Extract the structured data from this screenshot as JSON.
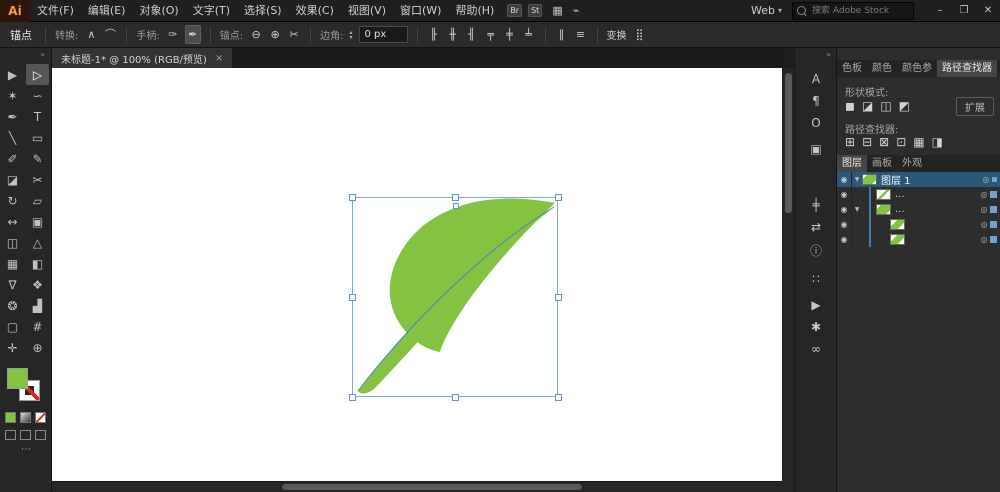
{
  "colors": {
    "leaf_green": "#84C341",
    "selection_blue": "#7EA8DC",
    "handle_border": "#5F93CF",
    "path_blue": "#4A82C0",
    "layer_highlight": "#2B5878",
    "layer_indicator": "#3D7AB3",
    "art_square": "#6EA3D6",
    "accent_orange": "#FF9A3E"
  },
  "menubar": {
    "logo": "Ai",
    "items": [
      "文件(F)",
      "编辑(E)",
      "对象(O)",
      "文字(T)",
      "选择(S)",
      "效果(C)",
      "视图(V)",
      "窗口(W)",
      "帮助(H)"
    ],
    "badges": [
      {
        "name": "bridge-badge",
        "label": "Br"
      },
      {
        "name": "stock-badge",
        "label": "St"
      }
    ],
    "icons": [
      {
        "name": "arrange-documents-icon",
        "glyph": "▦"
      },
      {
        "name": "workspace-icon",
        "glyph": "⌁"
      }
    ],
    "workspace": {
      "label": "Web",
      "caret": "▾"
    },
    "search": {
      "placeholder": "搜索 Adobe Stock"
    },
    "window": {
      "minimize": "–",
      "restore": "❐",
      "close": "✕"
    }
  },
  "controlbar": {
    "title": "锚点",
    "convert_label": "转换:",
    "convert_icons": [
      {
        "name": "convert-corner-icon",
        "glyph": "∧"
      },
      {
        "name": "convert-smooth-icon",
        "glyph": "⌒"
      }
    ],
    "handles_label": "手柄:",
    "handle_icons": [
      {
        "name": "show-handles-icon",
        "glyph": "✑"
      },
      {
        "name": "hide-handles-icon",
        "glyph": "✒",
        "pressed": true
      }
    ],
    "anchors_label": "锚点:",
    "anchor_icons": [
      {
        "name": "remove-anchor-icon",
        "glyph": "⊖"
      },
      {
        "name": "add-anchor-icon",
        "glyph": "⊕"
      },
      {
        "name": "cut-path-icon",
        "glyph": "✂"
      }
    ],
    "corner_label": "边角:",
    "spinner_up": "▴",
    "spinner_down": "▾",
    "corner_value": "0 px",
    "align_icons": [
      {
        "name": "align-left-icon",
        "glyph": "╟"
      },
      {
        "name": "align-center-icon",
        "glyph": "╫"
      },
      {
        "name": "align-right-icon",
        "glyph": "╢"
      },
      {
        "name": "align-top-icon",
        "glyph": "╤"
      },
      {
        "name": "align-middle-icon",
        "glyph": "╪"
      },
      {
        "name": "align-bottom-icon",
        "glyph": "╧"
      }
    ],
    "distribute_icons": [
      {
        "name": "distribute-horizontal-icon",
        "glyph": "∥"
      },
      {
        "name": "distribute-vertical-icon",
        "glyph": "≡"
      }
    ],
    "transform_label": "变换",
    "more_icon": "⣿"
  },
  "document_tab": {
    "title": "未标题-1* @ 100% (RGB/预览)",
    "close": "×"
  },
  "toolbar": {
    "collapse": "»",
    "tools": [
      {
        "name": "selection-tool",
        "glyph": "▶"
      },
      {
        "name": "direct-selection-tool",
        "glyph": "▷",
        "active": true
      },
      {
        "name": "magic-wand-tool",
        "glyph": "✶"
      },
      {
        "name": "lasso-tool",
        "glyph": "∽"
      },
      {
        "name": "pen-tool",
        "glyph": "✒"
      },
      {
        "name": "type-tool",
        "glyph": "T"
      },
      {
        "name": "line-tool",
        "glyph": "╲"
      },
      {
        "name": "rectangle-tool",
        "glyph": "▭"
      },
      {
        "name": "paintbrush-tool",
        "glyph": "✐"
      },
      {
        "name": "pencil-tool",
        "glyph": "✎"
      },
      {
        "name": "eraser-tool",
        "glyph": "◪"
      },
      {
        "name": "scissors-tool",
        "glyph": "✂"
      },
      {
        "name": "rotate-tool",
        "glyph": "↻"
      },
      {
        "name": "scale-tool",
        "glyph": "▱"
      },
      {
        "name": "width-tool",
        "glyph": "↔"
      },
      {
        "name": "free-transform-tool",
        "glyph": "▣"
      },
      {
        "name": "shape-builder-tool",
        "glyph": "◫"
      },
      {
        "name": "perspective-grid-tool",
        "glyph": "△"
      },
      {
        "name": "mesh-tool",
        "glyph": "▦"
      },
      {
        "name": "gradient-tool",
        "glyph": "◧"
      },
      {
        "name": "eyedropper-tool",
        "glyph": "∇"
      },
      {
        "name": "blend-tool",
        "glyph": "❖"
      },
      {
        "name": "symbol-sprayer-tool",
        "glyph": "❂"
      },
      {
        "name": "graph-tool",
        "glyph": "▟"
      },
      {
        "name": "artboard-tool",
        "glyph": "▢"
      },
      {
        "name": "slice-tool",
        "glyph": "#"
      },
      {
        "name": "hand-tool",
        "glyph": "✛"
      },
      {
        "name": "zoom-tool",
        "glyph": "⊕"
      }
    ],
    "swatches": {
      "fill_color": "#84C341",
      "stroke": "none"
    },
    "mini_buttons": [
      {
        "name": "color-button"
      },
      {
        "name": "gradient-button"
      },
      {
        "name": "none-button"
      }
    ],
    "draw_modes": [
      {
        "name": "draw-normal-button"
      },
      {
        "name": "draw-behind-button"
      },
      {
        "name": "draw-inside-button"
      }
    ],
    "ellipsis": "⋯"
  },
  "panel_strip": {
    "collapse": "»",
    "icons": [
      {
        "name": "character-panel-icon",
        "glyph": "A"
      },
      {
        "name": "paragraph-panel-icon",
        "glyph": "¶"
      },
      {
        "name": "opentype-panel-icon",
        "glyph": "O"
      },
      {
        "name": "artboards-panel-icon",
        "glyph": "▣"
      },
      {
        "name": "align-panel-icon",
        "glyph": "╪"
      },
      {
        "name": "transform-panel-icon",
        "glyph": "⇄"
      },
      {
        "name": "info-panel-icon",
        "glyph": "ⓘ"
      },
      {
        "name": "swatches-panel-icon",
        "glyph": "∷"
      },
      {
        "name": "symbols-panel-icon",
        "glyph": "▶"
      },
      {
        "name": "graphic-styles-panel-icon",
        "glyph": "✱"
      },
      {
        "name": "links-panel-icon",
        "glyph": "∞"
      }
    ]
  },
  "panels": {
    "tabs": [
      {
        "label": "色板"
      },
      {
        "label": "颜色"
      },
      {
        "label": "颜色参"
      },
      {
        "label": "路径查找器",
        "active": true
      }
    ],
    "pathfinder": {
      "shape_modes_label": "形状模式:",
      "shape_mode_icons": [
        {
          "name": "unite-icon",
          "glyph": "◼"
        },
        {
          "name": "minus-front-icon",
          "glyph": "◪"
        },
        {
          "name": "intersect-icon",
          "glyph": "◫"
        },
        {
          "name": "exclude-icon",
          "glyph": "◩"
        }
      ],
      "expand_button": "扩展",
      "pathfinders_label": "路径查找器:",
      "pathfinder_icons": [
        {
          "name": "divide-icon",
          "glyph": "⊞"
        },
        {
          "name": "trim-icon",
          "glyph": "⊟"
        },
        {
          "name": "merge-icon",
          "glyph": "⊠"
        },
        {
          "name": "crop-icon",
          "glyph": "⊡"
        },
        {
          "name": "outline-icon",
          "glyph": "▦"
        },
        {
          "name": "minus-back-icon",
          "glyph": "◨"
        }
      ]
    },
    "layers": {
      "tabs": [
        {
          "label": "图层",
          "active": true
        },
        {
          "label": "画板"
        },
        {
          "label": "外观"
        }
      ],
      "eye_glyph": "◉",
      "target_glyph": "◎",
      "expander_glyph": "▼",
      "rows": [
        {
          "label": "图层 1",
          "selected": true,
          "expand": true,
          "indent": 0,
          "thumb": "leaf"
        },
        {
          "label": "...",
          "selected": false,
          "expand": false,
          "indent": 1,
          "thumb": "sliver"
        },
        {
          "label": "...",
          "selected": false,
          "expand": true,
          "indent": 1,
          "thumb": "leaf"
        },
        {
          "label": "",
          "selected": false,
          "expand": false,
          "indent": 2,
          "thumb": "leaf2"
        },
        {
          "label": "",
          "selected": false,
          "expand": false,
          "indent": 2,
          "thumb": "leaf2"
        }
      ]
    }
  }
}
